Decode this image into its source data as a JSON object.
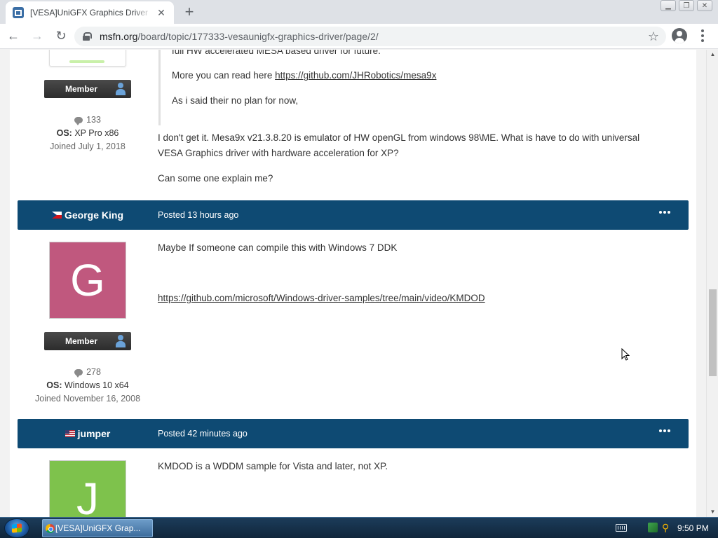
{
  "browser": {
    "tab_title": "[VESA]UniGFX Graphics Driver - V",
    "url_host": "msfn.org",
    "url_path": "/board/topic/177333-vesaunigfx-graphics-driver/page/2/"
  },
  "post1": {
    "rank": "Member",
    "post_count": "133",
    "os_label": "OS:",
    "os_value": "XP Pro x86",
    "joined": "Joined July 1, 2018",
    "quote_line1": "full HW accelerated MESA based driver for future.",
    "quote_line2_prefix": "More you can read here ",
    "quote_link": "https://github.com/JHRobotics/mesa9x",
    "quote_line3": "As i said their no plan for now,",
    "body_line1": "I don't get it. Mesa9x v21.3.8.20 is emulator of HW openGL from windows 98\\ME. What is have to do with universal",
    "body_line2": "VESA Graphics driver with hardware acceleration for XP?",
    "body_line3": "Can some one explain me?"
  },
  "post2": {
    "author": "George King",
    "posted": "Posted 13 hours ago",
    "avatar_letter": "G",
    "avatar_color": "#c0587e",
    "rank": "Member",
    "post_count": "278",
    "os_label": "OS:",
    "os_value": "Windows 10 x64",
    "joined": "Joined November 16, 2008",
    "body_line1": "Maybe If someone can compile this with Windows 7 DDK",
    "body_link": "https://github.com/microsoft/Windows-driver-samples/tree/main/video/KMDOD"
  },
  "post3": {
    "author": "jumper",
    "posted": "Posted 42 minutes ago",
    "avatar_letter": "J",
    "avatar_color": "#7ec24c",
    "body_line1": "KMDOD is a WDDM sample for Vista and later, not XP."
  },
  "taskbar": {
    "task_label": "[VESA]UniGFX Grap...",
    "clock": "9:50 PM"
  },
  "colors": {
    "post_header": "#0e4a73"
  }
}
